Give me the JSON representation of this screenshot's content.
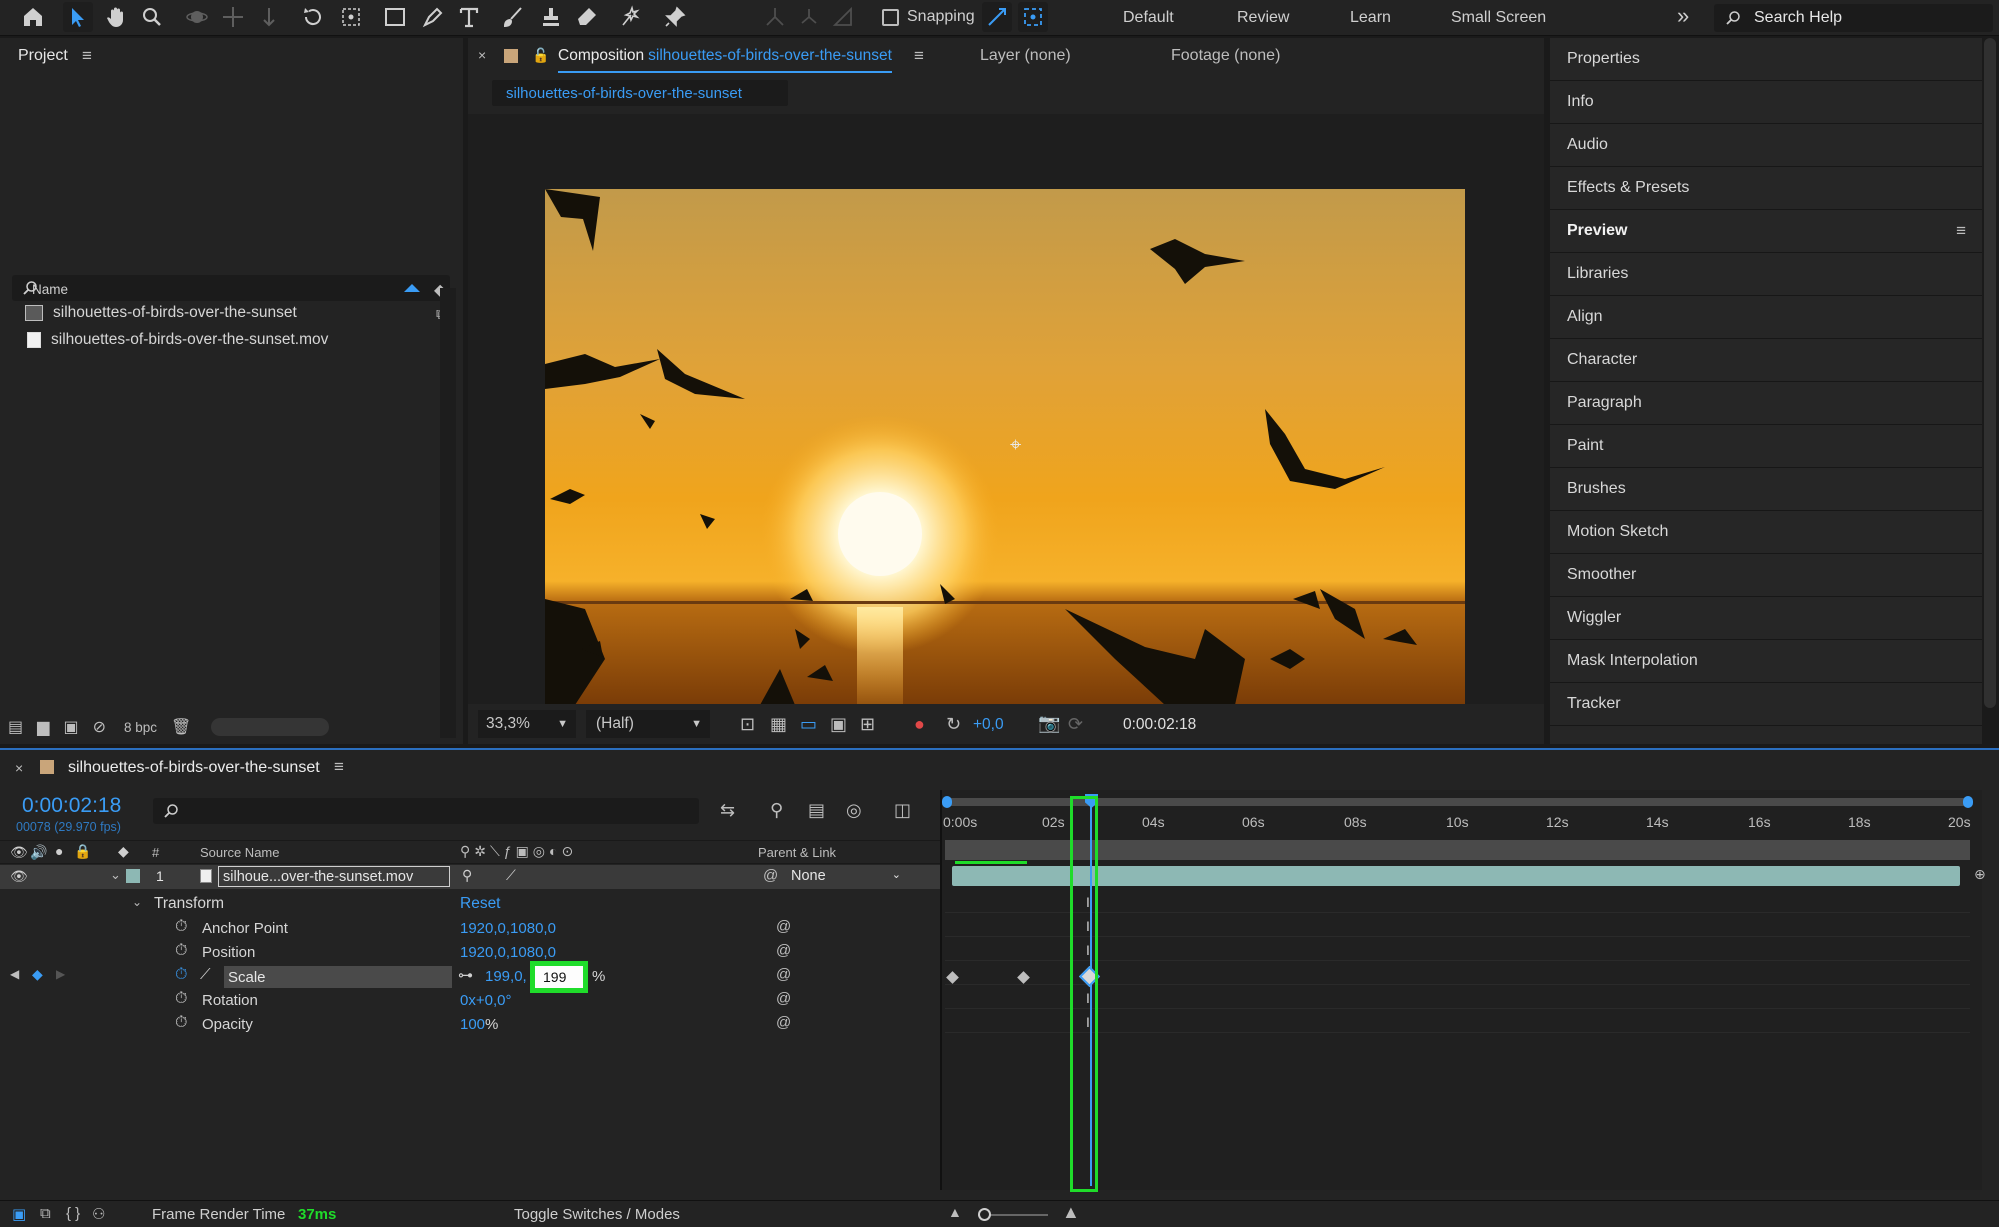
{
  "toolbar": {
    "snapping_label": "Snapping",
    "workspaces": [
      "Default",
      "Review",
      "Learn",
      "Small Screen"
    ],
    "more_label": "»",
    "search_placeholder": "Search Help"
  },
  "project": {
    "title": "Project",
    "column_name": "Name",
    "items": [
      {
        "name": "silhouettes-of-birds-over-the-sunset",
        "icon": "composition-icon"
      },
      {
        "name": "silhouettes-of-birds-over-the-sunset.mov",
        "icon": "footage-icon"
      }
    ],
    "bpc_label": "8 bpc"
  },
  "composition": {
    "tab_prefix": "Composition",
    "tab_name": "silhouettes-of-birds-over-the-sunset",
    "layer_tab": "Layer (none)",
    "footage_tab": "Footage (none)",
    "subtab": "silhouettes-of-birds-over-the-sunset",
    "zoom": "33,3%",
    "resolution": "(Half)",
    "exposure": "+0,0",
    "timecode": "0:00:02:18"
  },
  "right_panels": [
    "Properties",
    "Info",
    "Audio",
    "Effects & Presets",
    "Preview",
    "Libraries",
    "Align",
    "Character",
    "Paragraph",
    "Paint",
    "Brushes",
    "Motion Sketch",
    "Smoother",
    "Wiggler",
    "Mask Interpolation",
    "Tracker"
  ],
  "timeline": {
    "comp_name": "silhouettes-of-birds-over-the-sunset",
    "timecode": "0:00:02:18",
    "frame_info": "00078 (29.970 fps)",
    "col_source_name": "Source Name",
    "col_number": "#",
    "col_parent": "Parent & Link",
    "layer": {
      "number": "1",
      "name": "silhoue...over-the-sunset.mov",
      "parent": "None"
    },
    "transform_label": "Transform",
    "reset_label": "Reset",
    "properties": [
      {
        "name": "Anchor Point",
        "value": "1920,0,1080,0"
      },
      {
        "name": "Position",
        "value": "1920,0,1080,0"
      },
      {
        "name": "Scale",
        "value_x": "199,0,",
        "input_value": "199",
        "unit": "%"
      },
      {
        "name": "Rotation",
        "value": "0x+0,0°"
      },
      {
        "name": "Opacity",
        "value": "100",
        "unit": "%"
      }
    ],
    "ruler": [
      "0:00s",
      "02s",
      "04s",
      "06s",
      "08s",
      "10s",
      "12s",
      "14s",
      "16s",
      "18s",
      "20s"
    ],
    "footer_render_label": "Frame Render Time",
    "footer_render_value": "37ms",
    "footer_toggle": "Toggle Switches / Modes"
  },
  "colors": {
    "accent": "#3a9cf5",
    "highlight": "#1fdc2a",
    "track": "#8db8b4"
  }
}
